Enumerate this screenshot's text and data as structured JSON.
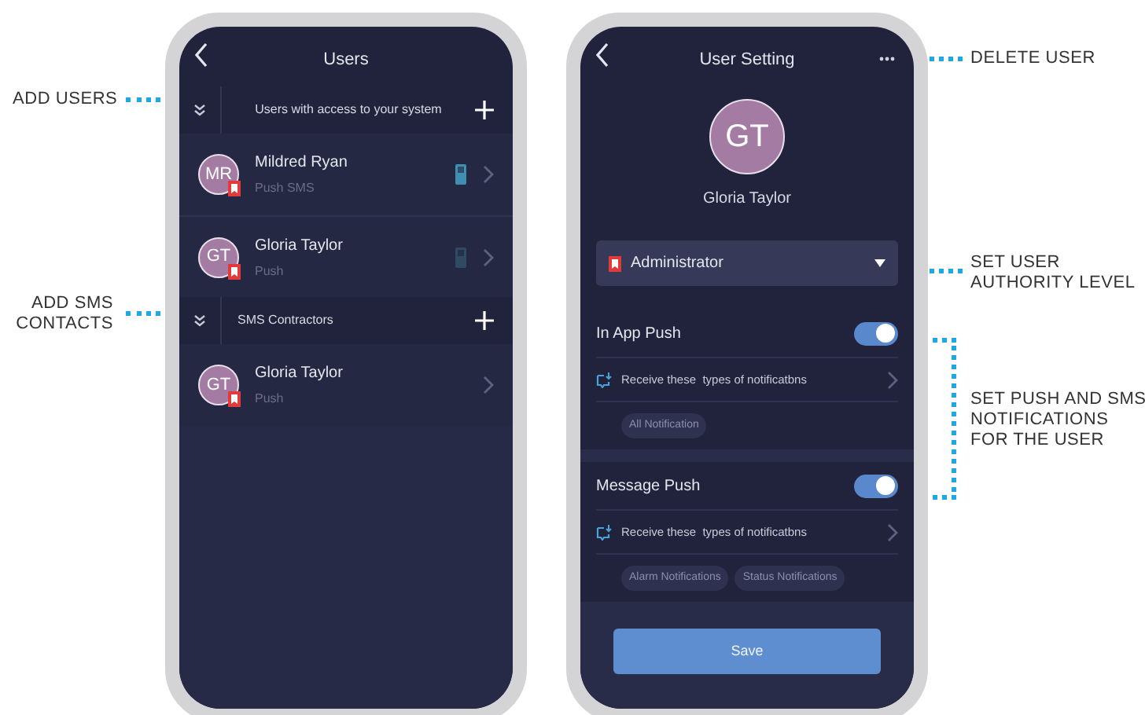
{
  "left_callouts": [
    {
      "text": "ADD USERS"
    },
    {
      "text": "ADD SMS\nCONTACTS"
    }
  ],
  "right_callouts": [
    {
      "text": "DELETE USER"
    },
    {
      "text": "SET USER\nAUTHORITY LEVEL"
    },
    {
      "text": "SET PUSH AND SMS\nNOTIFICATIONS\nFOR THE USER"
    }
  ],
  "users_screen": {
    "title": "Users",
    "sections": [
      {
        "title": "Users with access to your system",
        "items": [
          {
            "initials": "MR",
            "name": "Mildred Ryan",
            "subtitle": "Push SMS",
            "phone_icon": true,
            "sms_on": true
          },
          {
            "initials": "GT",
            "name": "Gloria Taylor",
            "subtitle": "Push",
            "phone_icon": true,
            "sms_on": false
          }
        ]
      },
      {
        "title": "SMS Contractors",
        "items": [
          {
            "initials": "GT",
            "name": "Gloria Taylor",
            "subtitle": "Push",
            "phone_icon": false
          }
        ]
      }
    ]
  },
  "settings_screen": {
    "title": "User Setting",
    "initials": "GT",
    "name": "Gloria Taylor",
    "role": "Administrator",
    "push_groups": [
      {
        "title": "In App Push",
        "on": true,
        "action": "Receive these  types of notificatbns",
        "chips": [
          "All Notification"
        ]
      },
      {
        "title": "Message Push",
        "on": true,
        "action": "Receive these  types of notificatbns",
        "chips": [
          "Alarm Notifications",
          "Status Notifications"
        ]
      }
    ],
    "save": "Save"
  }
}
